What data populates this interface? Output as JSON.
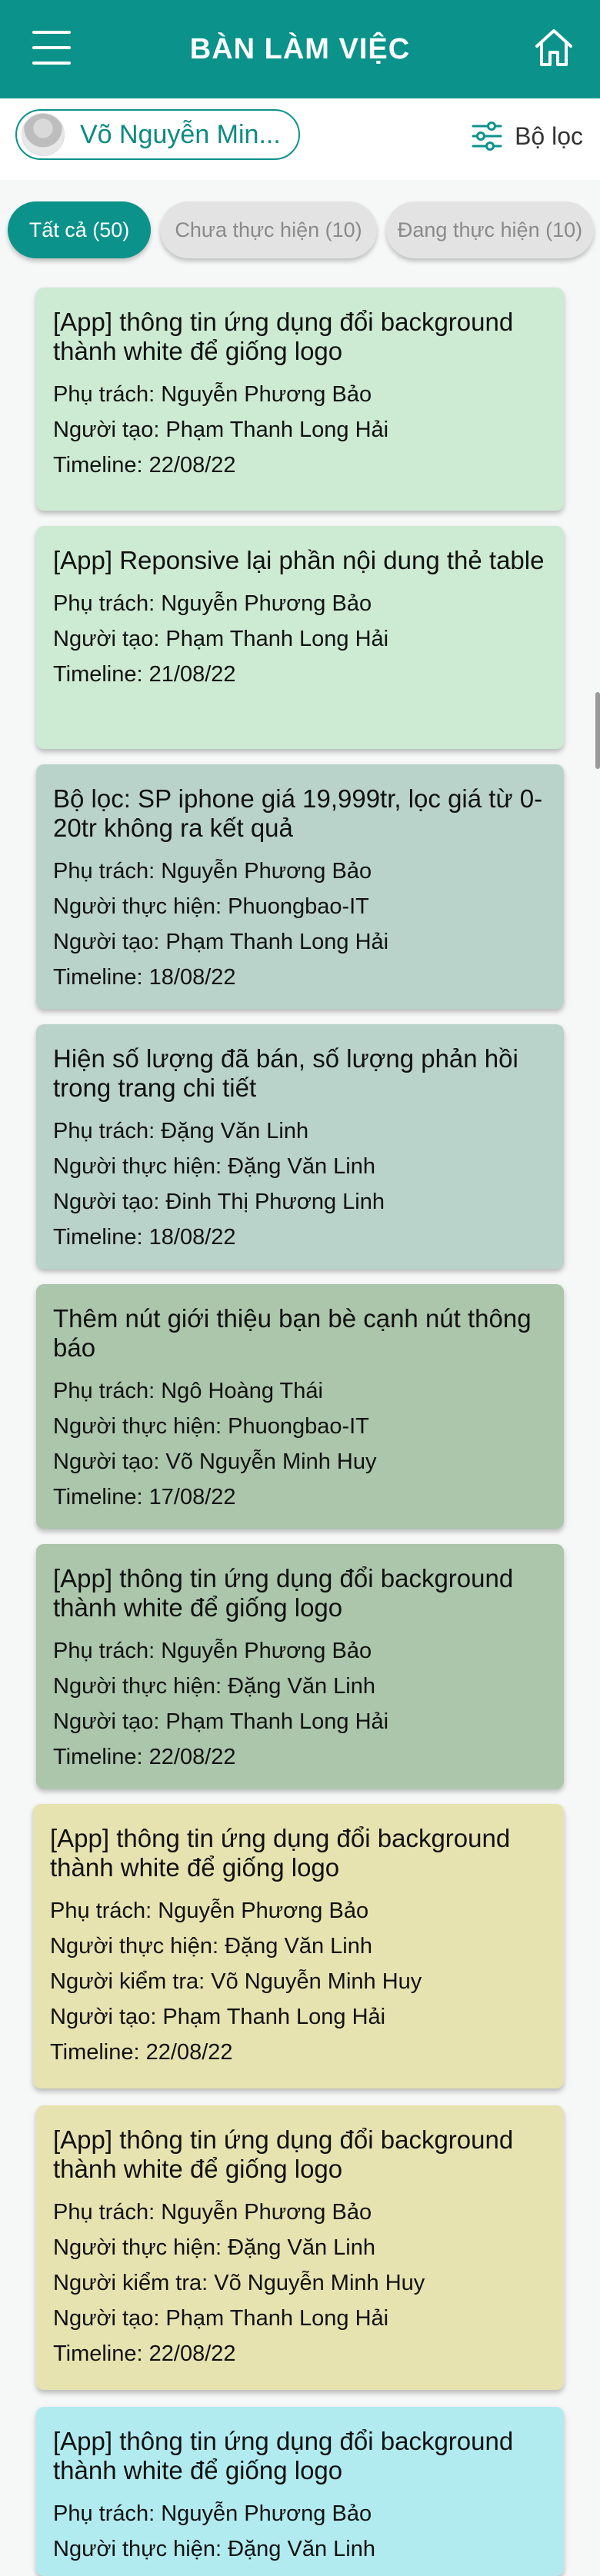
{
  "header": {
    "title": "BÀN LÀM VIỆC",
    "menu_icon": "hamburger-menu-icon",
    "home_icon": "home-icon"
  },
  "user": {
    "name": "Võ Nguyễn Min..."
  },
  "filter": {
    "label": "Bộ lọc",
    "icon": "sliders-icon"
  },
  "tabs": [
    {
      "label": "Tất cả (50)",
      "active": true
    },
    {
      "label": "Chưa thực hiện (10)",
      "active": false
    },
    {
      "label": "Đang thực hiện (10)",
      "active": false
    }
  ],
  "colors": {
    "primary": "#0b928a",
    "card_light_green": "#cdebd2",
    "card_gray_green": "#b9d3cb",
    "card_sage": "#abc6ab",
    "card_yellow": "#e7e3b1",
    "card_cyan": "#b1ebef"
  },
  "tasks": [
    {
      "title": "[App] thông tin ứng dụng đổi background thành white để giống logo",
      "lines": [
        "Phụ trách: Nguyễn Phương Bảo",
        "Người tạo: Phạm Thanh Long Hải",
        "Timeline: 22/08/22"
      ]
    },
    {
      "title": "[App] Reponsive lại phần nội dung thẻ table",
      "lines": [
        "Phụ trách: Nguyễn Phương Bảo",
        "Người tạo: Phạm Thanh Long Hải",
        "Timeline: 21/08/22"
      ]
    },
    {
      "title": "Bộ lọc: SP iphone giá 19,999tr, lọc giá từ 0-20tr không ra kết quả",
      "lines": [
        "Phụ trách: Nguyễn Phương Bảo",
        "Người thực hiện: Phuongbao-IT",
        "Người tạo: Phạm Thanh Long Hải",
        "Timeline: 18/08/22"
      ]
    },
    {
      "title": "Hiện số lượng đã bán, số lượng phản hồi trong trang chi tiết",
      "lines": [
        "Phụ trách: Đặng Văn Linh",
        "Người thực hiện: Đặng Văn Linh",
        "Người tạo: Đinh Thị Phương Linh",
        "Timeline: 18/08/22"
      ]
    },
    {
      "title": "Thêm nút giới thiệu bạn bè cạnh nút thông báo",
      "lines": [
        "Phụ trách: Ngô Hoàng Thái",
        "Người thực hiện: Phuongbao-IT",
        "Người tạo: Võ Nguyễn Minh Huy",
        "Timeline: 17/08/22"
      ]
    },
    {
      "title": "[App] thông tin ứng dụng đổi background thành white để giống logo",
      "lines": [
        "Phụ trách: Nguyễn Phương Bảo",
        "Người thực hiện: Đặng Văn Linh",
        "Người tạo: Phạm Thanh Long Hải",
        "Timeline: 22/08/22"
      ]
    },
    {
      "title": "[App] thông tin ứng dụng đổi background thành white để giống logo",
      "lines": [
        "Phụ trách: Nguyễn Phương Bảo",
        "Người thực hiện: Đặng Văn Linh",
        "Người kiểm tra: Võ Nguyễn Minh Huy",
        "Người tạo: Phạm Thanh Long Hải",
        "Timeline: 22/08/22"
      ]
    },
    {
      "title": "[App] thông tin ứng dụng đổi background thành white để giống logo",
      "lines": [
        "Phụ trách: Nguyễn Phương Bảo",
        "Người thực hiện: Đặng Văn Linh",
        "Người kiểm tra: Võ Nguyễn Minh Huy",
        "Người tạo: Phạm Thanh Long Hải",
        "Timeline: 22/08/22"
      ]
    },
    {
      "title": "[App] thông tin ứng dụng đổi background thành white để giống logo",
      "lines": [
        "Phụ trách: Nguyễn Phương Bảo",
        "Người thực hiện: Đặng Văn Linh"
      ]
    }
  ]
}
